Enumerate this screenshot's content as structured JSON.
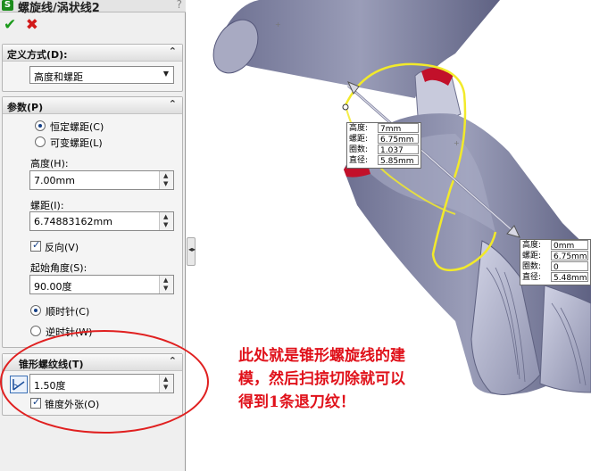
{
  "window": {
    "title": "螺旋线/涡状线2",
    "help_glyph": "?"
  },
  "actions": {
    "ok_glyph": "✔",
    "cancel_glyph": "✖"
  },
  "definition": {
    "header": "定义方式(D):",
    "selected": "高度和螺距"
  },
  "params": {
    "header": "参数(P)",
    "pitch_constant": "恒定螺距(C)",
    "pitch_variable": "可变螺距(L)",
    "height_label": "高度(H):",
    "height_value": "7.00mm",
    "pitch_label": "螺距(I):",
    "pitch_value": "6.74883162mm",
    "reverse_label": "反向(V)",
    "start_angle_label": "起始角度(S):",
    "start_angle_value": "90.00度",
    "clockwise": "顺时针(C)",
    "counterclockwise": "逆时针(W)"
  },
  "taper": {
    "header": "锥形螺纹线(T)",
    "angle_value": "1.50度",
    "outward_label": "锥度外张(O)"
  },
  "callouts": {
    "top": {
      "height_key": "高度:",
      "height_val": "7mm",
      "pitch_key": "螺距:",
      "pitch_val": "6.75mm",
      "turns_key": "圈数:",
      "turns_val": "1.037",
      "dia_key": "直径:",
      "dia_val": "5.85mm"
    },
    "bottom": {
      "height_key": "高度:",
      "height_val": "0mm",
      "pitch_key": "螺距:",
      "pitch_val": "6.75mm",
      "turns_key": "圈数:",
      "turns_val": "0",
      "dia_key": "直径:",
      "dia_val": "5.48mm"
    }
  },
  "annotation": {
    "line1": "此处就是锥形螺旋线的建",
    "line2": "模，然后扫掠切除就可以",
    "line3": "得到1条退刀纹！"
  },
  "icons": {
    "chevron_up": "⌃",
    "combo_arrow": "▼",
    "spin_up": "▲",
    "spin_down": "▼",
    "splitter": "◂▸"
  },
  "colors": {
    "helix_yellow": "#f2ea2a",
    "part_gray": "#8f92ad",
    "annotation_red": "#e0111a"
  }
}
